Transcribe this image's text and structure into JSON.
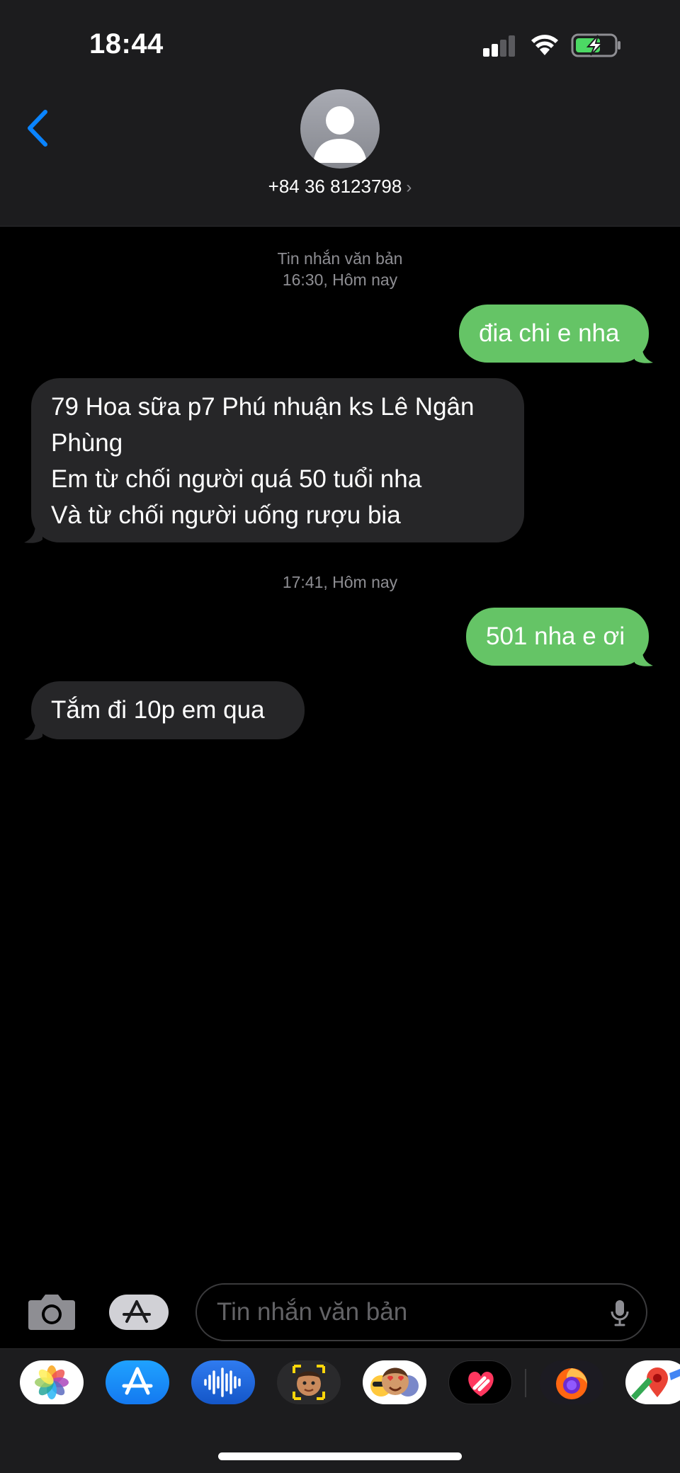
{
  "status_bar": {
    "time": "18:44"
  },
  "header": {
    "contact": "+84 36 8123798",
    "chevron": "›",
    "back_icon": "chevron-left-icon"
  },
  "conversation": {
    "section1": {
      "label": "Tin nhắn văn bản",
      "time": "16:30, Hôm nay"
    },
    "section2": {
      "time": "17:41, Hôm nay"
    },
    "messages": [
      {
        "side": "sent",
        "text": "đia chi e nha"
      },
      {
        "side": "received",
        "lines": [
          "79 Hoa sữa p7 Phú nhuận ks Lê Ngân",
          "Phùng",
          "Em từ chối người quá 50 tuổi nha",
          "Và từ chối người uống rượu bia"
        ]
      },
      {
        "side": "sent",
        "text": "501 nha e ơi"
      },
      {
        "side": "received",
        "text": "Tắm đi 10p em qua"
      }
    ]
  },
  "composer": {
    "placeholder": "Tin nhắn văn bản",
    "camera_icon": "camera-icon",
    "apps_icon": "app-store-icon",
    "mic_icon": "microphone-icon"
  },
  "app_drawer": {
    "apps": [
      "photos-icon",
      "app-store-icon",
      "audio-message-icon",
      "memoji-icon",
      "animoji-stickers-icon",
      "digital-touch-icon",
      "firefox-icon",
      "google-maps-icon"
    ]
  },
  "colors": {
    "sent_bubble": "#65c466",
    "received_bubble": "#262628",
    "accent": "#0a84ff",
    "background": "#000000",
    "header_bg": "#1c1c1e"
  }
}
